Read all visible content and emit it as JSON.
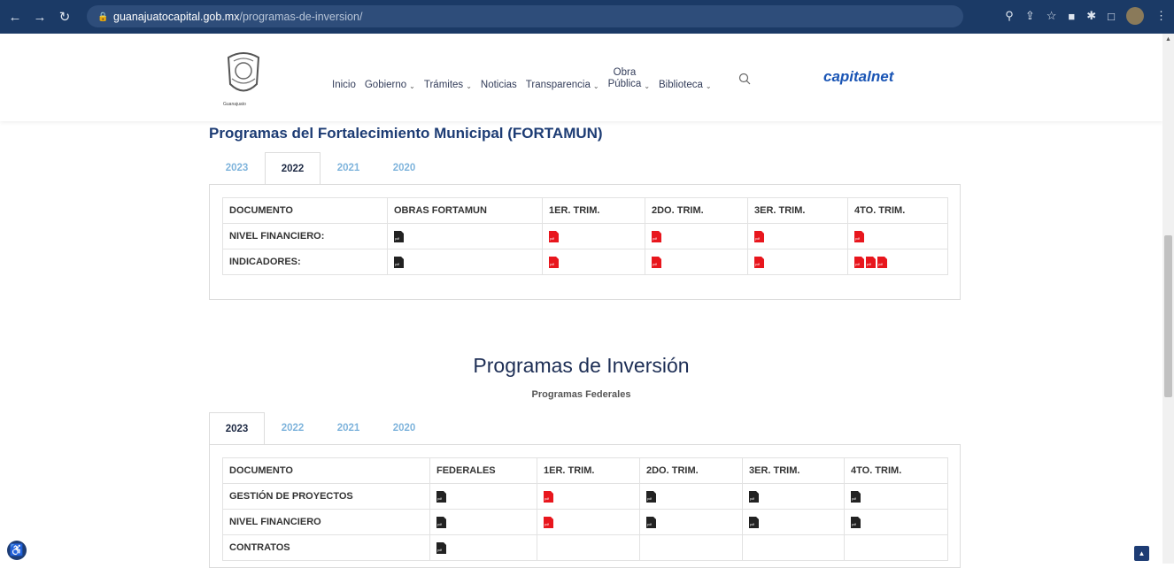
{
  "browser": {
    "url_host": "guanajuatocapital.gob.mx",
    "url_path": "/programas-de-inversion/"
  },
  "site": {
    "logo_text": "Guanajuato",
    "nav": [
      {
        "label": "Inicio"
      },
      {
        "label": "Gobierno"
      },
      {
        "label": "Trámites"
      },
      {
        "label": "Noticias"
      },
      {
        "label": "Transparencia"
      },
      {
        "label_top": "Obra",
        "label_bottom": "Pública"
      },
      {
        "label": "Biblioteca"
      }
    ],
    "brand_capital": "capital",
    "brand_net": "net"
  },
  "fortamun": {
    "title": "Programas del Fortalecimiento Municipal (FORTAMUN)",
    "tabs": [
      "2023",
      "2022",
      "2021",
      "2020"
    ],
    "active_tab": "2022",
    "headers": [
      "DOCUMENTO",
      "OBRAS FORTAMUN",
      "1ER. TRIM.",
      "2DO. TRIM.",
      "3ER. TRIM.",
      "4TO. TRIM."
    ],
    "rows": [
      {
        "label": "NIVEL FINANCIERO:",
        "cells": [
          [
            "black"
          ],
          [
            "red"
          ],
          [
            "red"
          ],
          [
            "red"
          ],
          [
            "red"
          ]
        ]
      },
      {
        "label": "INDICADORES:",
        "cells": [
          [
            "black"
          ],
          [
            "red"
          ],
          [
            "red"
          ],
          [
            "red"
          ],
          [
            "red",
            "red",
            "red"
          ]
        ]
      }
    ]
  },
  "inversion": {
    "title": "Programas de Inversión",
    "subtitle": "Programas Federales",
    "tabs": [
      "2023",
      "2022",
      "2021",
      "2020"
    ],
    "active_tab": "2023",
    "headers": [
      "DOCUMENTO",
      "FEDERALES",
      "1ER. TRIM.",
      "2DO. TRIM.",
      "3ER. TRIM.",
      "4TO. TRIM."
    ],
    "rows": [
      {
        "label": "GESTIÓN DE PROYECTOS",
        "cells": [
          [
            "black"
          ],
          [
            "red"
          ],
          [
            "black"
          ],
          [
            "black"
          ],
          [
            "black"
          ]
        ]
      },
      {
        "label": "NIVEL FINANCIERO",
        "cells": [
          [
            "black"
          ],
          [
            "red"
          ],
          [
            "black"
          ],
          [
            "black"
          ],
          [
            "black"
          ]
        ]
      },
      {
        "label": "CONTRATOS",
        "cells": [
          [
            "black"
          ],
          [],
          [],
          [],
          []
        ]
      }
    ]
  },
  "colors": {
    "accent": "#1d3c74",
    "pdf_red": "#e8161d",
    "pdf_black": "#222222",
    "tab_inactive": "#7fb4dc"
  }
}
